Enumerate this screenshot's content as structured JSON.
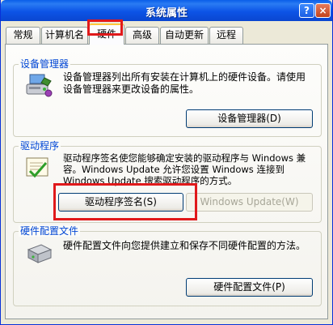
{
  "window": {
    "title": "系统属性",
    "help_label": "?",
    "close_label": "×"
  },
  "tabs": [
    {
      "label": "常规"
    },
    {
      "label": "计算机名"
    },
    {
      "label": "硬件"
    },
    {
      "label": "高级"
    },
    {
      "label": "自动更新"
    },
    {
      "label": "远程"
    }
  ],
  "device_manager": {
    "label": "设备管理器",
    "description": "设备管理器列出所有安装在计算机上的硬件设备。请使用设备管理器来更改设备的属性。",
    "button": "设备管理器(D)"
  },
  "drivers": {
    "label": "驱动程序",
    "description": "驱动程序签名使您能够确定安装的驱动程序与 Windows 兼容。Windows Update 允许您设置 Windows 连接到 Windows Update 搜索驱动程序的方式。",
    "signing_button": "驱动程序签名(S)",
    "update_button": "Windows Update(W)"
  },
  "hardware_profiles": {
    "label": "硬件配置文件",
    "description": "硬件配置文件向您提供建立和保存不同硬件配置的方法。",
    "button": "硬件配置文件(P)"
  },
  "icons": {
    "device_manager": "computer-devices-icon",
    "drivers": "certificate-checkmark-icon",
    "hardware_profiles": "hardware-profile-icon"
  },
  "colors": {
    "titlebar": "#0a5ee9",
    "group_label": "#0046d5",
    "highlight": "#e0191b",
    "active_tab_accent": "#ffc83c"
  }
}
